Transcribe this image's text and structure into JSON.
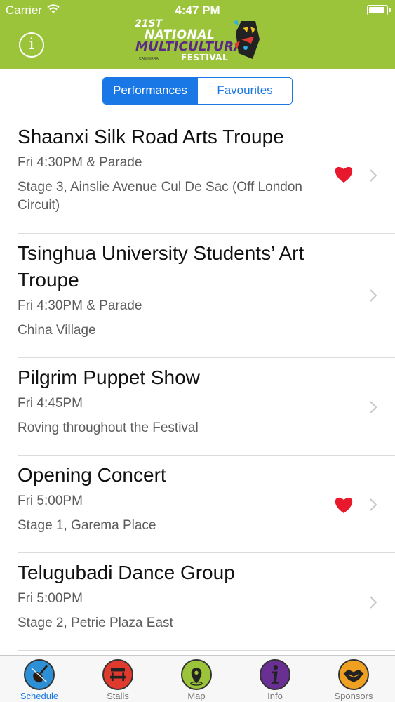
{
  "status_bar": {
    "carrier": "Carrier",
    "time": "4:47 PM",
    "battery_level": 0.95
  },
  "header": {
    "logo": {
      "line0": "21ST",
      "line1": "NATIONAL",
      "line2": "MULTICULTURAL",
      "line3": "FESTIVAL",
      "small": "CANBERRA"
    }
  },
  "segments": [
    {
      "label": "Performances",
      "selected": true
    },
    {
      "label": "Favourites",
      "selected": false
    }
  ],
  "performances": [
    {
      "title": "Shaanxi Silk Road Arts Troupe",
      "time": "Fri 4:30PM & Parade",
      "venue": "Stage 3, Ainslie Avenue Cul De Sac (Off London Circuit)",
      "favourite": true
    },
    {
      "title": "Tsinghua University Students’ Art Troupe",
      "time": "Fri 4:30PM & Parade",
      "venue": "China Village",
      "favourite": false
    },
    {
      "title": "Pilgrim Puppet Show",
      "time": "Fri 4:45PM",
      "venue": "Roving throughout the Festival",
      "favourite": false
    },
    {
      "title": "Opening Concert",
      "time": "Fri 5:00PM",
      "venue": "Stage 1, Garema Place",
      "favourite": true
    },
    {
      "title": "Telugubadi Dance Group",
      "time": "Fri 5:00PM",
      "venue": "Stage 2, Petrie Plaza East",
      "favourite": false
    }
  ],
  "tabbar": [
    {
      "label": "Schedule",
      "icon": "violin-icon",
      "color": "#2d8fd5",
      "active": true
    },
    {
      "label": "Stalls",
      "icon": "stall-icon",
      "color": "#e03a2f",
      "active": false
    },
    {
      "label": "Map",
      "icon": "map-pin-icon",
      "color": "#9bc43b",
      "active": false
    },
    {
      "label": "Info",
      "icon": "info-icon",
      "color": "#6a2f93",
      "active": false
    },
    {
      "label": "Sponsors",
      "icon": "handshake-icon",
      "color": "#f0a020",
      "active": false
    }
  ],
  "colors": {
    "header": "#9bc43b",
    "accent": "#1a78e6",
    "heart": "#e8192c"
  }
}
